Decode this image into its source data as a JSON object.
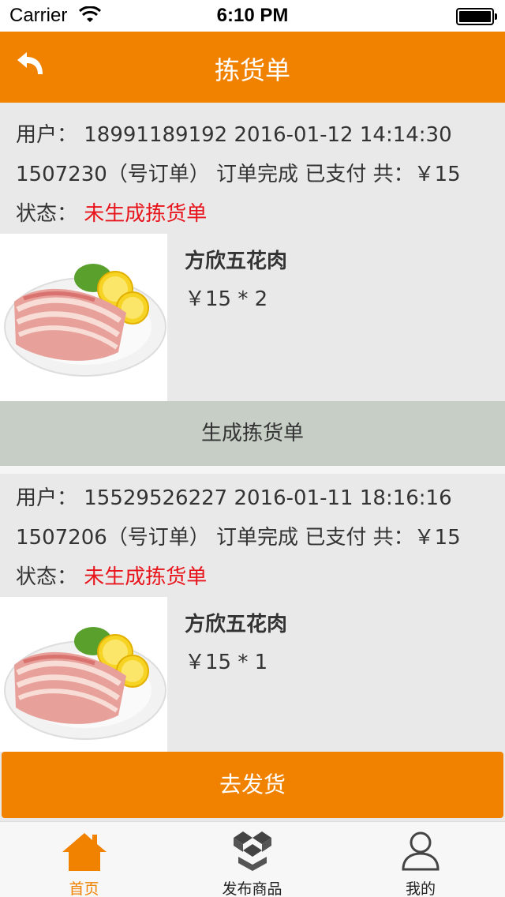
{
  "status_bar": {
    "carrier": "Carrier",
    "time": "6:10 PM"
  },
  "nav": {
    "title": "拣货单"
  },
  "orders": [
    {
      "user_line": "用户： 18991189192 2016-01-12 14:14:30",
      "order_line": "1507230（号订单） 订单完成 已支付 共：￥15",
      "state_label": "状态：",
      "state_value": "未生成拣货单",
      "product_name": "方欣五花肉",
      "product_price": "￥15 * 2"
    },
    {
      "user_line": "用户： 15529526227 2016-01-11 18:16:16",
      "order_line": "1507206（号订单） 订单完成 已支付 共：￥15",
      "state_label": "状态：",
      "state_value": "未生成拣货单",
      "product_name": "方欣五花肉",
      "product_price": "￥15 * 1"
    }
  ],
  "generate_button": "生成拣货单",
  "ship_button": "去发货",
  "tabs": [
    {
      "label": "首页",
      "icon": "home-icon",
      "active": true
    },
    {
      "label": "发布商品",
      "icon": "boxes-icon",
      "active": false
    },
    {
      "label": "我的",
      "icon": "user-icon",
      "active": false
    }
  ],
  "colors": {
    "accent": "#f08200",
    "status_red": "#e8161c",
    "button_gray": "#c6cec6"
  }
}
